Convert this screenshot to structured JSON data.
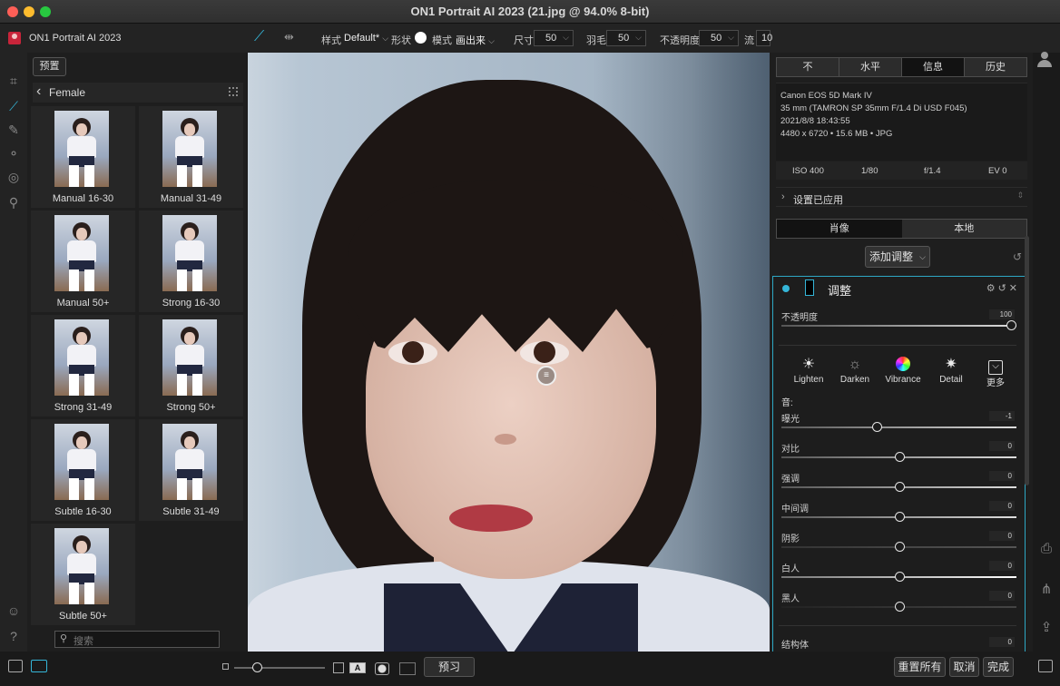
{
  "window": {
    "title": "ON1 Portrait AI 2023 (21.jpg @ 94.0% 8-bit)"
  },
  "app": {
    "name": "ON1 Portrait AI 2023"
  },
  "toolbar": {
    "style_label": "样式",
    "style_value": "Default*",
    "shape_label": "形状",
    "mode_label": "模式",
    "mode_value": "画出来",
    "size_label": "尺寸",
    "size_value": "50",
    "feather_label": "羽毛",
    "feather_value": "50",
    "opacity_label": "不透明度",
    "opacity_value": "50",
    "flow_label": "流",
    "flow_value": "10"
  },
  "presets": {
    "button_label": "预置",
    "category": "Female",
    "items": [
      {
        "name": "Manual 16-30"
      },
      {
        "name": "Manual 31-49"
      },
      {
        "name": "Manual 50+"
      },
      {
        "name": "Strong 16-30"
      },
      {
        "name": "Strong 31-49"
      },
      {
        "name": "Strong 50+"
      },
      {
        "name": "Subtle 16-30"
      },
      {
        "name": "Subtle 31-49"
      },
      {
        "name": "Subtle 50+"
      }
    ],
    "search_placeholder": "搜索"
  },
  "right_panel": {
    "tabs": [
      "不",
      "水平",
      "信息",
      "历史"
    ],
    "selected_tab": "信息",
    "info": {
      "camera": "Canon EOS 5D Mark IV",
      "lens": "35 mm (TAMRON SP 35mm F/1.4 Di USD F045)",
      "datetime": "2021/8/8  18:43:55",
      "dimensions": "4480 x 6720 • 15.6 MB • JPG"
    },
    "exif": {
      "iso": "ISO 400",
      "shutter": "1/80",
      "aperture": "f/1.4",
      "ev": "EV 0"
    },
    "settings_applied": "设置已应用",
    "mode_tabs": [
      "肖像",
      "本地"
    ],
    "add_adjustment": "添加调整",
    "adjustment": {
      "title": "调整",
      "opacity_label": "不透明度",
      "opacity_value": "100",
      "opacity_level": 1.0,
      "presets": [
        "Lighten",
        "Darken",
        "Vibrance",
        "Detail",
        "更多"
      ],
      "tone_label": "音:",
      "sliders": [
        {
          "label": "曝光",
          "value": "-1"
        },
        {
          "label": "对比",
          "value": "0"
        },
        {
          "label": "强调",
          "value": "0"
        },
        {
          "label": "中间调",
          "value": "0"
        },
        {
          "label": "阴影",
          "value": "0"
        },
        {
          "label": "白人",
          "value": "0"
        },
        {
          "label": "黑人",
          "value": "0"
        },
        {
          "label": "结构体",
          "value": "0"
        }
      ]
    }
  },
  "bottom": {
    "preview_label": "预习",
    "reset_all": "重置所有",
    "cancel": "取消",
    "done": "完成"
  },
  "colors": {
    "accent": "#35b6d8",
    "panel": "#1e1e1e",
    "toolbar": "#232323"
  }
}
